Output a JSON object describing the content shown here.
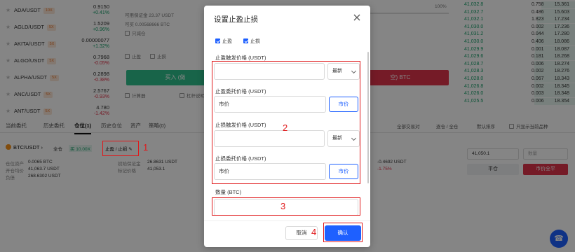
{
  "pairs": [
    {
      "name": "ADA/USDT",
      "lev": "10X",
      "price": "0.9150",
      "chg": "+0.41%",
      "dir": "up"
    },
    {
      "name": "AGLD/USDT",
      "lev": "5X",
      "price": "1.5209",
      "chg": "+0.96%",
      "dir": "up"
    },
    {
      "name": "AKITA/USDT",
      "lev": "5X",
      "price": "0.00000077",
      "chg": "+1.32%",
      "dir": "up"
    },
    {
      "name": "ALGO/USDT",
      "lev": "5X",
      "price": "0.7968",
      "chg": "-0.05%",
      "dir": "down"
    },
    {
      "name": "ALPHA/USDT",
      "lev": "5X",
      "price": "0.2898",
      "chg": "-0.38%",
      "dir": "down"
    },
    {
      "name": "ANC/USDT",
      "lev": "5X",
      "price": "2.5767",
      "chg": "-0.93%",
      "dir": "down"
    },
    {
      "name": "ANT/USDT",
      "lev": "5X",
      "price": "4.780",
      "chg": "-1.42%",
      "dir": "down"
    }
  ],
  "order_panel": {
    "available_margin": "可用保证金 23.37 USDT",
    "can_open": "可买 0.00568666 BTC",
    "reduce_only": "只减仓",
    "stop_profit": "止盈",
    "stop_loss": "止损",
    "buy_label": "买入 (做",
    "sell_label": "空) BTC",
    "calculator": "计算器",
    "leverage_hint": "杠杆说明",
    "percent_right": "100%"
  },
  "orderbook": [
    {
      "p": "41,032.8",
      "a": "0.758",
      "t": "15.361"
    },
    {
      "p": "41,032.7",
      "a": "0.486",
      "t": "15.603"
    },
    {
      "p": "41,032.1",
      "a": "1.823",
      "t": "17.234"
    },
    {
      "p": "41,030.0",
      "a": "0.002",
      "t": "17.236"
    },
    {
      "p": "41,031.2",
      "a": "0.044",
      "t": "17.280"
    },
    {
      "p": "41,030.0",
      "a": "0.406",
      "t": "18.086"
    },
    {
      "p": "41,029.9",
      "a": "0.001",
      "t": "18.087"
    },
    {
      "p": "41,029.6",
      "a": "0.181",
      "t": "18.268"
    },
    {
      "p": "41,028.7",
      "a": "0.006",
      "t": "18.274"
    },
    {
      "p": "41,028.3",
      "a": "0.002",
      "t": "18.276"
    },
    {
      "p": "41,028.0",
      "a": "0.067",
      "t": "18.343"
    },
    {
      "p": "41,026.8",
      "a": "0.002",
      "t": "18.345"
    },
    {
      "p": "41,026.0",
      "a": "0.003",
      "t": "18.348"
    },
    {
      "p": "41,025.5",
      "a": "0.006",
      "t": "18.354"
    }
  ],
  "tabs": [
    "当前委托",
    "历史委托",
    "仓位(1)",
    "历史仓位",
    "资产",
    "策略(0)"
  ],
  "filters": {
    "all_pairs": "全部交易对",
    "mode": "逐仓 / 全仓",
    "sort": "默认排序",
    "show_current": "只显示当前品种"
  },
  "position": {
    "pair": "BTC/USDT",
    "mode": "全仓",
    "side_lev": "买 10.00X",
    "tpsl_link": "止盈 / 止损",
    "labels": [
      "仓位资产",
      "开仓均价",
      "负债"
    ],
    "values": [
      "0.0065 BTC",
      "41,063.7 USDT",
      "268.6302 USDT"
    ],
    "labels2": [
      "初始保证金",
      "标记价格"
    ],
    "values2": [
      "26.8631 USDT",
      "41,053.1"
    ],
    "pnl": "-0.4692 USDT",
    "roe": "-1.75%",
    "price_input": "41,050.1",
    "qty_placeholder": "数量",
    "close_btn": "平仓",
    "market_close_btn": "市价全平"
  },
  "modal": {
    "title": "设置止盈止损",
    "check_tp": "止盈",
    "check_sl": "止损",
    "tp_trigger_label": "止盈触发价格 (USDT)",
    "tp_trigger_select": "最新",
    "tp_order_label": "止盈委托价格 (USDT)",
    "tp_order_value": "市价",
    "tp_market_btn": "市价",
    "sl_trigger_label": "止损触发价格 (USDT)",
    "sl_trigger_select": "最新",
    "sl_order_label": "止损委托价格 (USDT)",
    "sl_order_value": "市价",
    "sl_market_btn": "市价",
    "qty_label": "数量 (BTC)",
    "cancel": "取消",
    "confirm": "确认"
  },
  "annotations": [
    "1",
    "2",
    "3",
    "4"
  ],
  "colors": {
    "accent": "#1e60ff",
    "up": "#1aa06b",
    "down": "#e0354b",
    "annotation": "#e0191b"
  }
}
